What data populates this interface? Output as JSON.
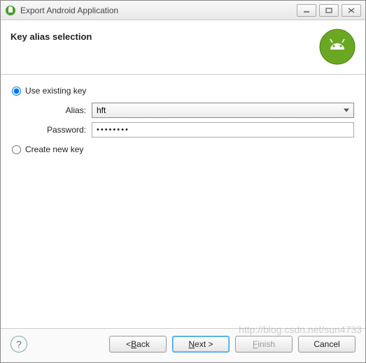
{
  "window": {
    "title": "Export Android Application"
  },
  "header": {
    "title": "Key alias selection"
  },
  "form": {
    "use_existing_label": "Use existing key",
    "alias_label": "Alias:",
    "alias_value": "hft",
    "password_label": "Password:",
    "password_value": "••••••••",
    "create_new_label": "Create new key",
    "selected_option": "use_existing"
  },
  "buttons": {
    "back": "< Back",
    "next": "Next >",
    "finish": "Finish",
    "cancel": "Cancel"
  },
  "watermark": "http://blog.csdn.net/sun4733"
}
